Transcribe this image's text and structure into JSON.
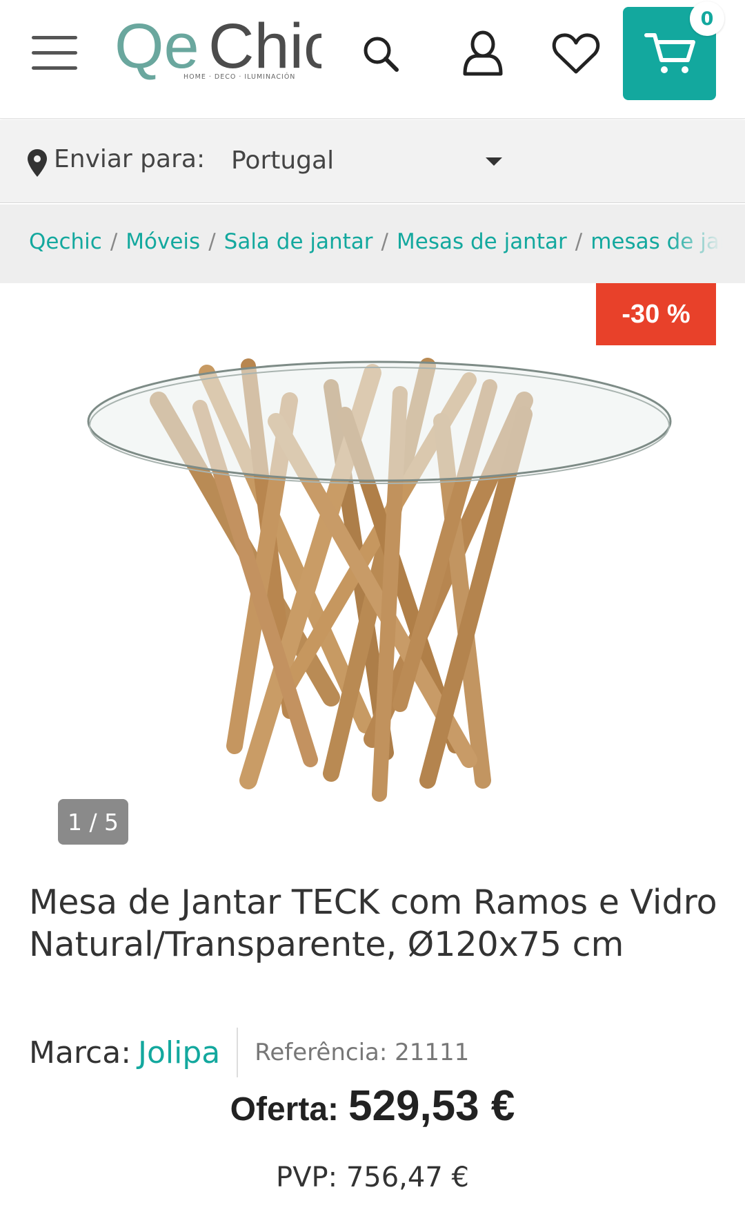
{
  "header": {
    "logo_text": "QeChic",
    "logo_tagline": "HOME · DECO · ILUMINACIÓN",
    "cart_count": "0",
    "accent_color": "#13a89e"
  },
  "shipping": {
    "label": "Enviar para:",
    "selected_country": "Portugal"
  },
  "breadcrumb": {
    "items": [
      "Qechic",
      "Móveis",
      "Sala de jantar",
      "Mesas de jantar",
      "mesas de jantar"
    ]
  },
  "gallery": {
    "discount_badge": "-30 %",
    "counter": "1 / 5"
  },
  "product": {
    "title": "Mesa de Jantar TECK com Ramos e Vidro Natural/Transparente, Ø120x75 cm",
    "brand_label": "Marca:",
    "brand_name": "Jolipa",
    "reference": "Referência: 21111",
    "offer_label": "Oferta:",
    "offer_price": "529,53 €",
    "pvp": "PVP: 756,47 €"
  },
  "icons": [
    "menu-icon",
    "search-icon",
    "user-icon",
    "heart-icon",
    "cart-icon",
    "location-pin-icon",
    "chevron-down-icon"
  ]
}
